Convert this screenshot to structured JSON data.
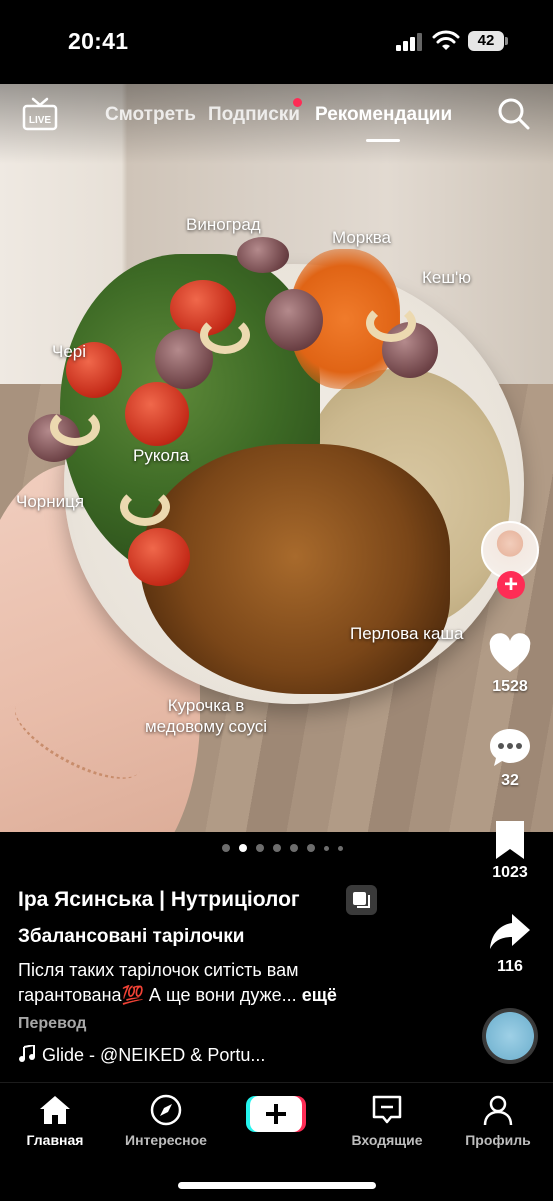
{
  "status_bar": {
    "time": "20:41",
    "battery": "42"
  },
  "top_nav": {
    "live_label": "LIVE",
    "tabs": [
      {
        "label": "Смотреть"
      },
      {
        "label": "Подписки"
      },
      {
        "label": "Рекомендации"
      }
    ],
    "active_tab": "Рекомендации",
    "accent_color": "#fe2c55"
  },
  "media": {
    "labels": {
      "grape": "Виноград",
      "carrot": "Морква",
      "cashew": "Кеш'ю",
      "cherry": "Чері",
      "arugula": "Рукола",
      "blueberry": "Чорниця",
      "barley": "Перлова каша",
      "chicken_line1": "Курочка в",
      "chicken_line2": "медовому соусі"
    },
    "pages": 8,
    "current_page": 2
  },
  "rail": {
    "likes": "1528",
    "comments": "32",
    "saves": "1023",
    "shares": "116"
  },
  "caption": {
    "author": "Іра Ясинська | Нутриціолог",
    "title": "Збалансовані тарілочки",
    "description_line1": "Після таких тарілочок ситість вам",
    "description_line2": "гарантована💯  А ще вони дуже...",
    "more": "ещё",
    "translate": "Перевод",
    "music": "Glide - @NEIKED & Portu..."
  },
  "tabbar": {
    "home": "Главная",
    "discover": "Интересное",
    "inbox": "Входящие",
    "profile": "Профиль"
  }
}
